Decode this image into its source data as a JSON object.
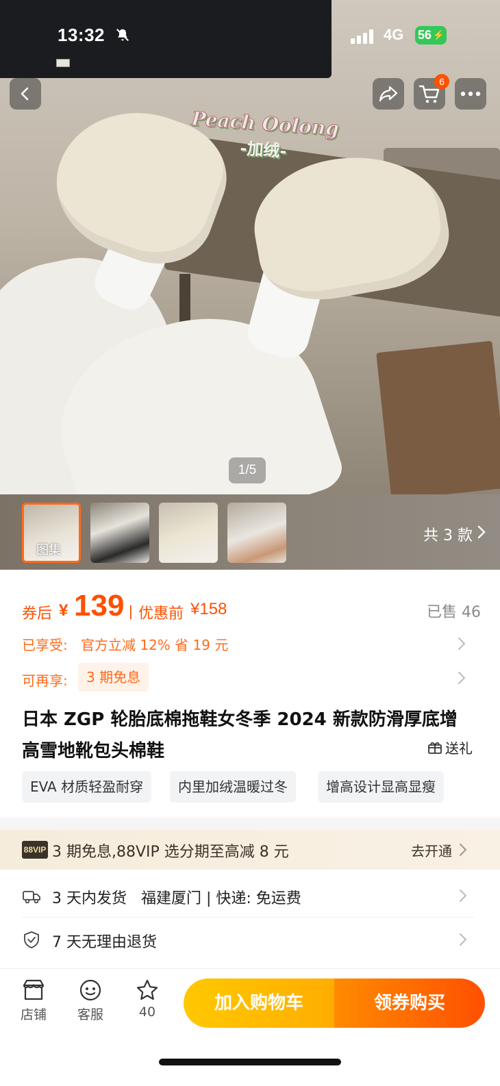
{
  "status_bar": {
    "time": "13:32",
    "network": "4G",
    "battery": "56"
  },
  "header": {
    "cart_badge": "6"
  },
  "hero": {
    "brand_title": "Peach Oolong",
    "brand_subtitle": "-加绒-",
    "page_indicator": "1/5"
  },
  "gallery": {
    "first_thumb_label": "图集",
    "variants_link": "共 3 款"
  },
  "price": {
    "label": "券后",
    "currency": "¥",
    "value": "139",
    "separator": "|",
    "original_label": "优惠前",
    "original_price": "¥158",
    "sold": "已售 46"
  },
  "promotions": [
    {
      "label": "已享受:",
      "text": "官方立减 12% 省 19 元"
    },
    {
      "label": "可再享:",
      "text": "3 期免息"
    }
  ],
  "product": {
    "title": "日本 ZGP 轮胎底棉拖鞋女冬季 2024 新款防滑厚底增高雪地靴包头棉鞋",
    "gift_label": "送礼"
  },
  "tags": [
    "EVA 材质轻盈耐穿",
    "内里加绒温暖过冬",
    "增高设计显高显瘦"
  ],
  "vip": {
    "badge": "88VIP",
    "text": "3 期免息,88VIP 选分期至高减 8 元",
    "cta": "去开通"
  },
  "info_rows": [
    {
      "text": "3 天内发货   福建厦门 | 快递: 免运费"
    },
    {
      "text": "7 天无理由退货"
    }
  ],
  "bottom_bar": {
    "store_label": "店铺",
    "service_label": "客服",
    "favorite_count": "40",
    "add_to_cart": "加入购物车",
    "buy_now": "领券购买"
  },
  "colors": {
    "accent": "#ff5000",
    "cart_button": "#ffb800",
    "buy_button": "#ff5000",
    "vip_bg": "#f6ecdc"
  }
}
